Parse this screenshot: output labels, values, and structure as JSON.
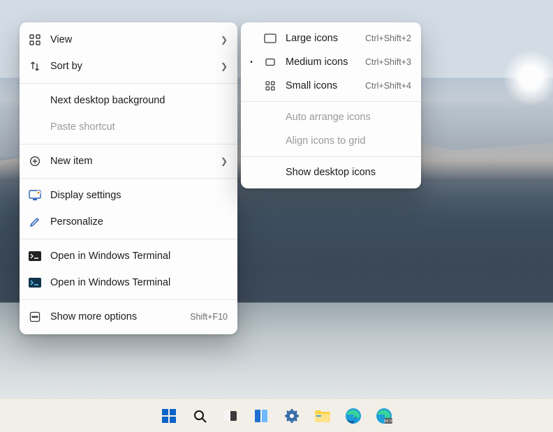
{
  "main_menu": {
    "groups": [
      [
        {
          "id": "view",
          "label": "View",
          "icon": "grid-icon",
          "submenu": true
        },
        {
          "id": "sort",
          "label": "Sort by",
          "icon": "sort-icon",
          "submenu": true
        }
      ],
      [
        {
          "id": "next-bg",
          "label": "Next desktop background",
          "icon": "",
          "submenu": false
        },
        {
          "id": "paste-shortcut",
          "label": "Paste shortcut",
          "icon": "",
          "disabled": true
        }
      ],
      [
        {
          "id": "new-item",
          "label": "New item",
          "icon": "plus-icon",
          "submenu": true
        }
      ],
      [
        {
          "id": "display",
          "label": "Display settings",
          "icon": "display-icon"
        },
        {
          "id": "personalize",
          "label": "Personalize",
          "icon": "pencil-icon"
        }
      ],
      [
        {
          "id": "terminal1",
          "label": "Open in Windows Terminal",
          "icon": "terminal-icon"
        },
        {
          "id": "terminal2",
          "label": "Open in Windows Terminal",
          "icon": "terminal-alt-icon"
        }
      ],
      [
        {
          "id": "more",
          "label": "Show more options",
          "icon": "more-icon",
          "hint": "Shift+F10"
        }
      ]
    ]
  },
  "sub_menu": {
    "groups": [
      [
        {
          "id": "large",
          "label": "Large icons",
          "icon": "rect-large-icon",
          "hint": "Ctrl+Shift+2"
        },
        {
          "id": "medium",
          "label": "Medium icons",
          "icon": "rect-medium-icon",
          "hint": "Ctrl+Shift+3",
          "selected": true
        },
        {
          "id": "small",
          "label": "Small icons",
          "icon": "grid-small-icon",
          "hint": "Ctrl+Shift+4"
        }
      ],
      [
        {
          "id": "auto",
          "label": "Auto arrange icons",
          "disabled": true
        },
        {
          "id": "align",
          "label": "Align icons to grid",
          "disabled": true
        }
      ],
      [
        {
          "id": "show",
          "label": "Show desktop icons"
        }
      ]
    ]
  },
  "taskbar": [
    "start-icon",
    "search-icon",
    "taskview-icon",
    "widgets-icon",
    "settings-icon",
    "explorer-icon",
    "edge-icon",
    "edge-beta-icon"
  ]
}
